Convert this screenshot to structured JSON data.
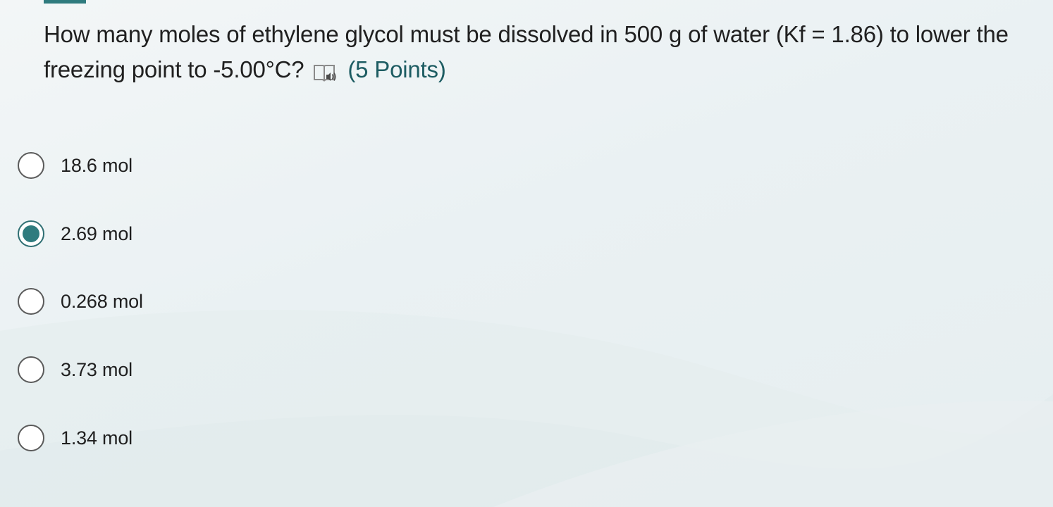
{
  "question": {
    "text": "How many moles of ethylene glycol must be dissolved in 500 g of water (Kf = 1.86) to lower the freezing point to -5.00°C?",
    "reader_icon": "immersive-reader-icon",
    "points": "(5 Points)"
  },
  "options": [
    {
      "label": "18.6 mol",
      "selected": false
    },
    {
      "label": "2.69 mol",
      "selected": true
    },
    {
      "label": "0.268 mol",
      "selected": false
    },
    {
      "label": "3.73 mol",
      "selected": false
    },
    {
      "label": "1.34 mol",
      "selected": false
    }
  ],
  "colors": {
    "accent": "#2f7b7e",
    "points_text": "#1d5c62"
  }
}
